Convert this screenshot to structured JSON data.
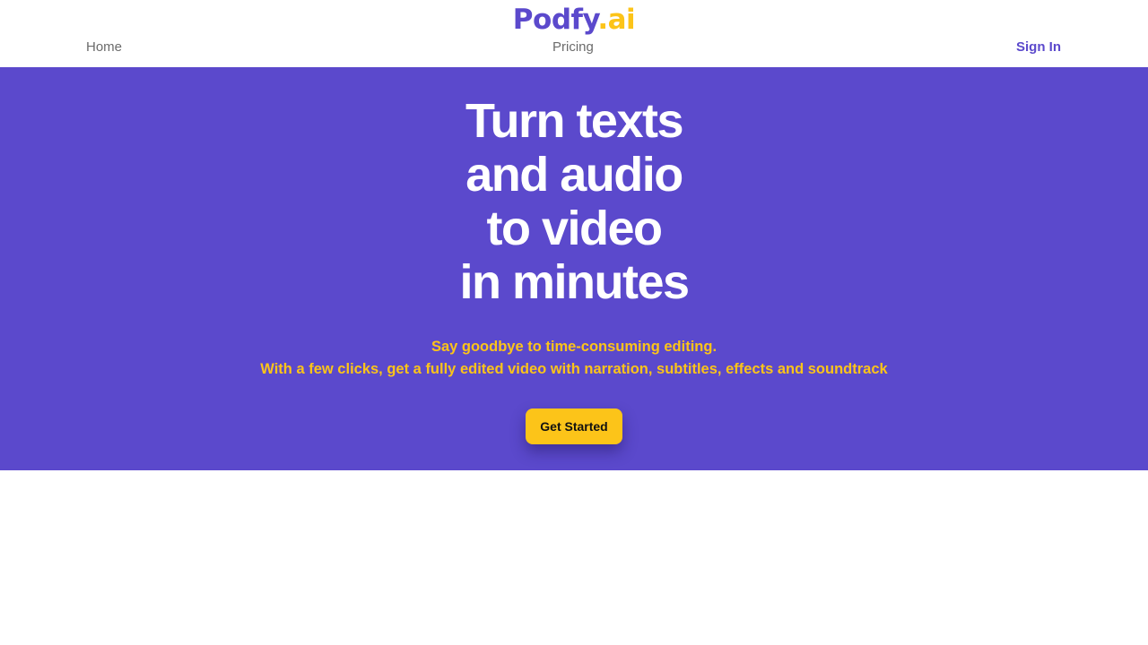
{
  "header": {
    "logo": {
      "brand": "Podfy",
      "tld": ".ai"
    },
    "nav": {
      "home": "Home",
      "pricing": "Pricing",
      "sign_in": "Sign In"
    }
  },
  "hero": {
    "headline": [
      "Turn texts",
      "and audio",
      "to video",
      "in minutes"
    ],
    "subtitle": [
      "Say goodbye to time-consuming editing.",
      "With a few clicks, get a fully edited video with narration, subtitles, effects and soundtrack"
    ],
    "cta_label": "Get Started"
  },
  "colors": {
    "brand_purple": "#5b49cc",
    "accent_yellow": "#fcc419",
    "nav_gray": "#6b6b6b",
    "text_white": "#ffffff"
  }
}
